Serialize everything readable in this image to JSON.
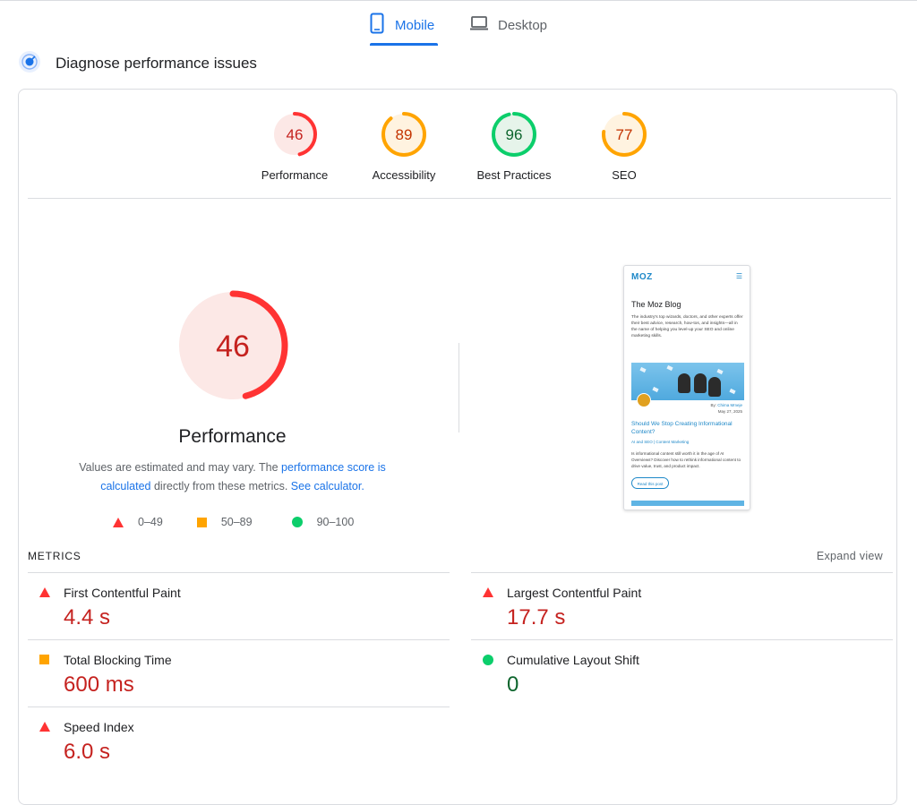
{
  "tabs": {
    "mobile": {
      "label": "Mobile",
      "active": true,
      "icon": "smartphone-icon"
    },
    "desktop": {
      "label": "Desktop",
      "active": false,
      "icon": "laptop-icon"
    }
  },
  "diagnose": {
    "title": "Diagnose performance issues",
    "icon": "diagnose-icon"
  },
  "scores": [
    {
      "label": "Performance",
      "value": "46",
      "score": 46,
      "rating": "fail",
      "color": "#ff3333",
      "bg": "#fce8e6",
      "text_color": "#c5221f"
    },
    {
      "label": "Accessibility",
      "value": "89",
      "score": 89,
      "rating": "average",
      "color": "#ffa400",
      "bg": "#fff3e0",
      "text_color": "#c33300"
    },
    {
      "label": "Best Practices",
      "value": "96",
      "score": 96,
      "rating": "pass",
      "color": "#0cce6b",
      "bg": "#e6f4ea",
      "text_color": "#0d652d"
    },
    {
      "label": "SEO",
      "value": "77",
      "score": 77,
      "rating": "average",
      "color": "#ffa400",
      "bg": "#fff3e0",
      "text_color": "#c33300"
    }
  ],
  "performance": {
    "value": "46",
    "score": 46,
    "title": "Performance",
    "note": {
      "pre": "Values are estimated and may vary. The ",
      "link1": "performance score is calculated",
      "mid": " directly from these metrics. ",
      "link2": "See calculator."
    }
  },
  "legend": [
    {
      "shape": "triangle",
      "range": "0–49",
      "color": "#ff3333"
    },
    {
      "shape": "square",
      "range": "50–89",
      "color": "#ffa400"
    },
    {
      "shape": "circle",
      "range": "90–100",
      "color": "#0cce6b"
    }
  ],
  "preview": {
    "logo": "MOZ",
    "title": "The Moz Blog",
    "description": "The industry's top wizards, doctors, and other experts offer their best advice, research, how-tos, and insights—all in the name of helping you level-up your SEO and online marketing skills.",
    "by_prefix": "By: ",
    "author": "Chima Mmeje",
    "date": "May 27, 2025",
    "post_title": "Should We Stop Creating Informational Content?",
    "categories": "AI and SEO | Content Marketing",
    "excerpt": "Is informational content still worth it in the age of AI Overviews? Discover how to rethink informational content to drive value, trust, and product impact.",
    "button": "Read this post"
  },
  "metrics": {
    "title": "METRICS",
    "expand_label": "Expand view",
    "items": [
      {
        "name": "First Contentful Paint",
        "value": "4.4 s",
        "rating": "fail"
      },
      {
        "name": "Largest Contentful Paint",
        "value": "17.7 s",
        "rating": "fail"
      },
      {
        "name": "Total Blocking Time",
        "value": "600 ms",
        "rating": "average"
      },
      {
        "name": "Cumulative Layout Shift",
        "value": "0",
        "rating": "pass"
      },
      {
        "name": "Speed Index",
        "value": "6.0 s",
        "rating": "fail"
      }
    ]
  }
}
